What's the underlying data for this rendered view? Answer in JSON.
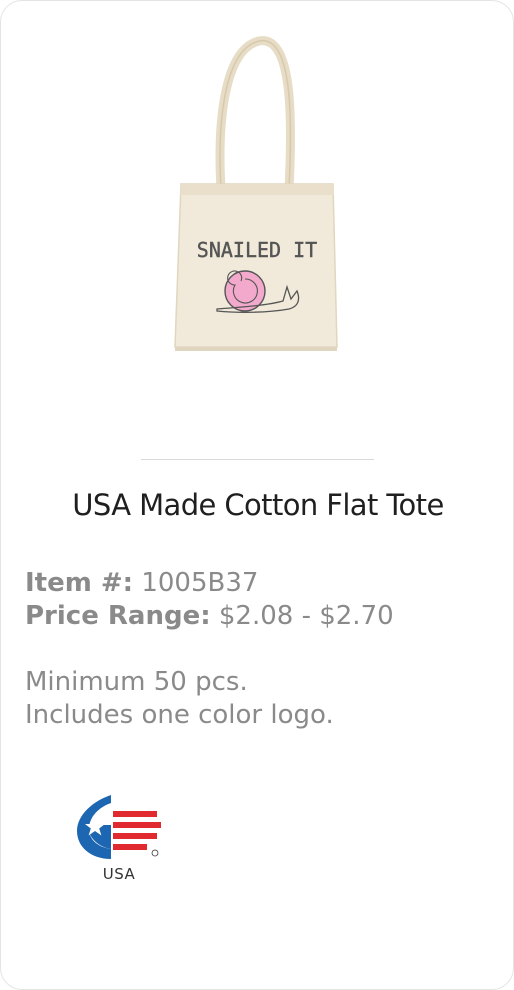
{
  "product": {
    "image_icon": "tote-bag-image",
    "bag_text": "SNAILED IT",
    "title": "USA Made Cotton Flat Tote",
    "item_label": "Item #:",
    "item_value": "1005B37",
    "price_label": "Price Range:",
    "price_value": "$2.08 - $2.70",
    "minimum_text": "Minimum 50 pcs.",
    "logo_text": "Includes one color logo."
  },
  "badge": {
    "icon": "usa-made-icon",
    "label": "USA"
  },
  "colors": {
    "title": "#1f1f1f",
    "meta_text": "#8a8a8a",
    "badge_blue": "#1d66b1",
    "badge_red": "#e02a2f"
  }
}
